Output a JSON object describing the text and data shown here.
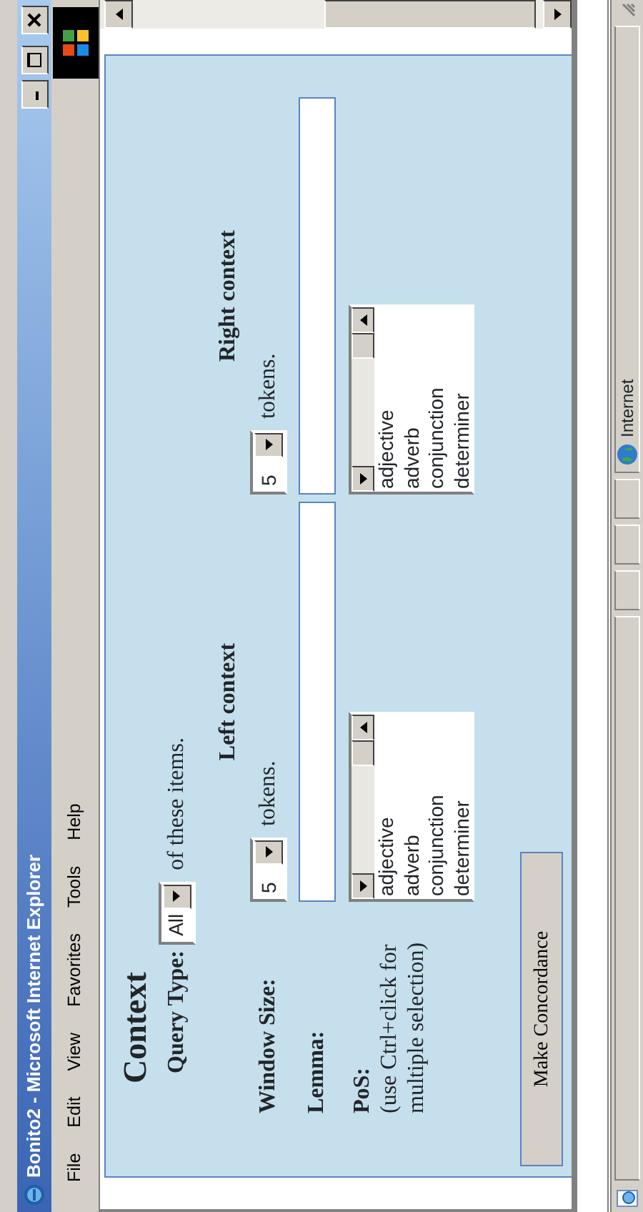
{
  "window": {
    "title": "Bonito2 - Microsoft Internet Explorer"
  },
  "menu": [
    "File",
    "Edit",
    "View",
    "Favorites",
    "Tools",
    "Help"
  ],
  "form": {
    "heading": "Context",
    "query_type": {
      "label": "Query Type:",
      "value": "All",
      "suffix": "of these items."
    },
    "columns": [
      "Left context",
      "Right context"
    ],
    "window_size": {
      "label": "Window Size:",
      "left": {
        "value": "5",
        "suffix": "tokens."
      },
      "right": {
        "value": "5",
        "suffix": "tokens."
      }
    },
    "lemma": {
      "label": "Lemma:"
    },
    "pos": {
      "label": "PoS:",
      "hint": "(use Ctrl+click for multiple selection)",
      "left_options": [
        {
          "label": "adjective",
          "selected": false
        },
        {
          "label": "adverb",
          "selected": false
        },
        {
          "label": "conjunction",
          "selected": false
        },
        {
          "label": "determiner",
          "selected": false
        }
      ],
      "right_options": [
        {
          "label": "adjective",
          "selected": false
        },
        {
          "label": "adverb",
          "selected": false
        },
        {
          "label": "conjunction",
          "selected": false
        },
        {
          "label": "determiner",
          "selected": false
        }
      ]
    },
    "submit": "Make Concordance"
  },
  "status_bar": {
    "zone": "Internet"
  }
}
